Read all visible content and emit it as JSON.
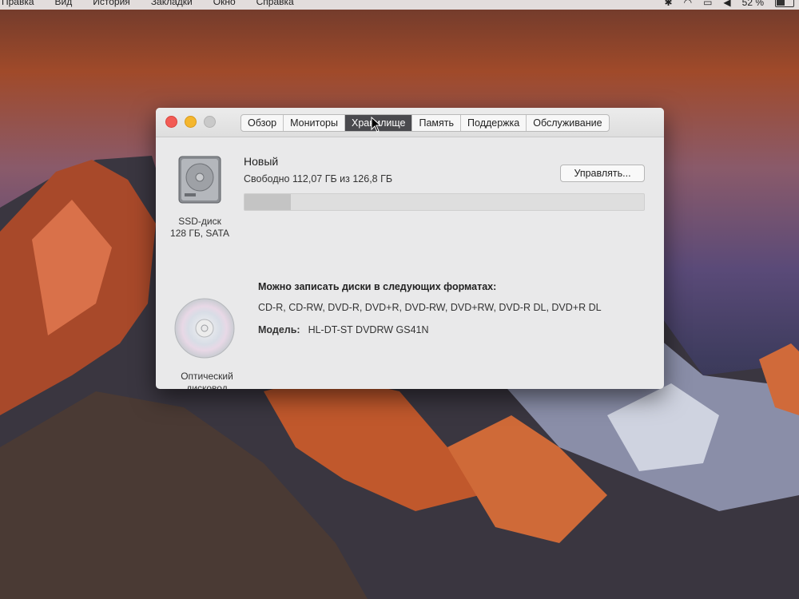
{
  "menubar": {
    "items": [
      "Правка",
      "Вид",
      "История",
      "Закладки",
      "Окно",
      "Справка"
    ],
    "battery": "52 %"
  },
  "window": {
    "tabs": [
      "Обзор",
      "Мониторы",
      "Хранилище",
      "Память",
      "Поддержка",
      "Обслуживание"
    ],
    "active_tab": "Хранилище",
    "drive": {
      "label_line1": "SSD-диск",
      "label_line2": "128 ГБ, SATA",
      "volume_name": "Новый",
      "free_text": "Свободно 112,07 ГБ из 126,8 ГБ",
      "used_fraction": 0.116,
      "manage_button": "Управлять..."
    },
    "optical": {
      "label_line1": "Оптический",
      "label_line2": "дисковод",
      "burn_title": "Можно записать диски в следующих форматах:",
      "formats": "CD-R, CD-RW, DVD-R, DVD+R, DVD-RW, DVD+RW, DVD-R DL, DVD+R DL",
      "model_label": "Модель:",
      "model_value": "HL-DT-ST DVDRW GS41N"
    }
  },
  "colors": {
    "active_tab": "#4a4a4e",
    "close": "#f25b55",
    "minimize": "#f4b62e"
  }
}
